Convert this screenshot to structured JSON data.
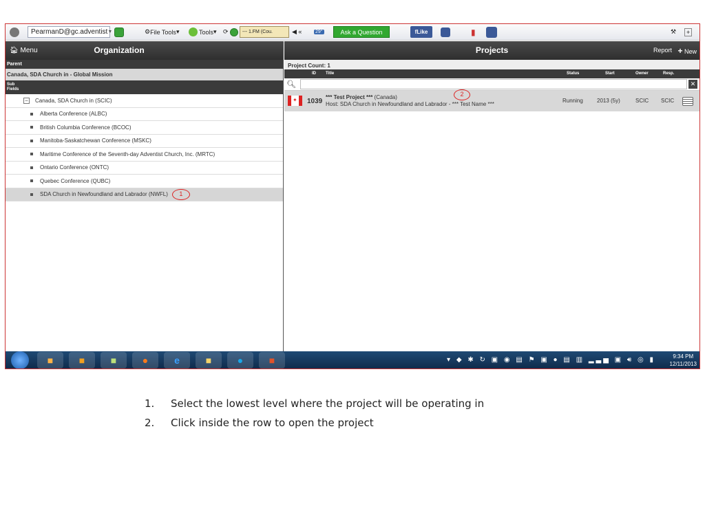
{
  "toolbar": {
    "email": "PearmanD@gc.adventist",
    "file_tools": "File Tools",
    "tools": "Tools",
    "radio": "--- 1.FM (Cou.",
    "weather": "29°",
    "ask": "Ask a Question",
    "like": "Like"
  },
  "left": {
    "menu_label": "Menu",
    "title": "Organization",
    "parent_label": "Parent",
    "parent_value": "Canada, SDA Church in - Global Mission",
    "sub_label": "Sub",
    "fields_label": "Fields",
    "root": "Canada, SDA Church in (SCIC)",
    "children": [
      "Alberta Conference (ALBC)",
      "British Columbia Conference (BCOC)",
      "Manitoba-Saskatchewan Conference (MSKC)",
      "Maritime Conference of the Seventh-day Adventist Church, Inc. (MRTC)",
      "Ontario Conference (ONTC)",
      "Quebec Conference (QUBC)",
      "SDA Church in Newfoundland and Labrador (NWFL)"
    ],
    "annotation": "1"
  },
  "right": {
    "title": "Projects",
    "report": "Report",
    "new": "New",
    "count": "Project Count: 1",
    "columns": {
      "id": "ID",
      "title": "Title",
      "status": "Status",
      "start": "Start",
      "owner": "Owner",
      "resp": "Resp."
    },
    "project": {
      "id": "1039",
      "title_bold": "*** Test Project ***",
      "title_rest": " (Canada)",
      "host": "Host: SDA Church in Newfoundland and Labrador - *** Test Name ***",
      "status": "Running",
      "start": "2013 (5y)",
      "owner": "SCIC",
      "resp": "SCIC"
    },
    "annotation": "2"
  },
  "taskbar": {
    "time": "9:34 PM",
    "date": "12/11/2013"
  },
  "instructions": [
    {
      "num": "1.",
      "text": "Select the lowest level where the project will be operating in"
    },
    {
      "num": "2.",
      "text": "Click inside the row to open the project"
    }
  ]
}
